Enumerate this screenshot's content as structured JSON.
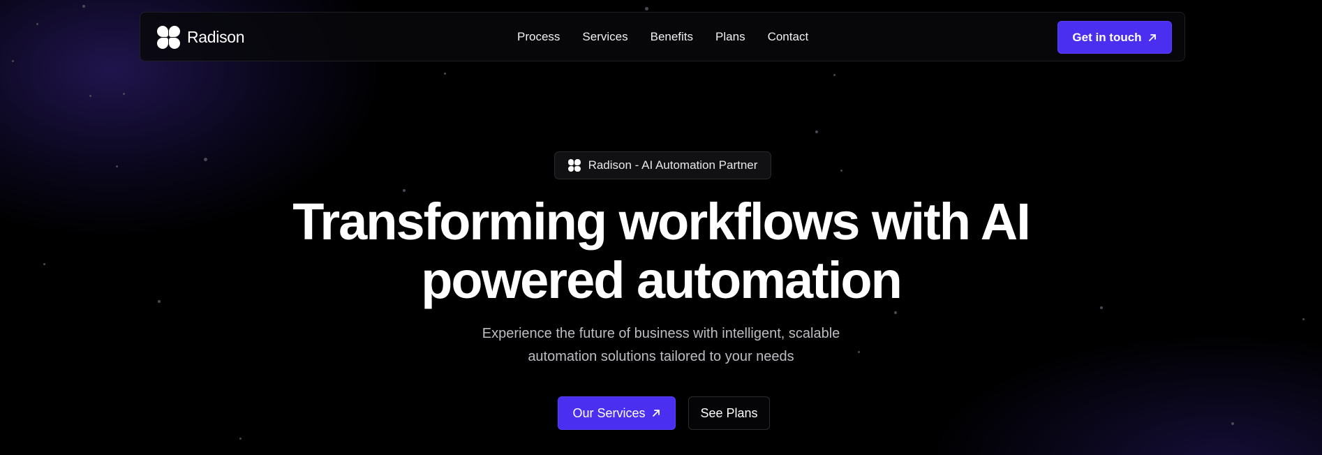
{
  "brand": {
    "name": "Radison",
    "logo_icon": "clover-logo-icon"
  },
  "nav": {
    "links": [
      "Process",
      "Services",
      "Benefits",
      "Plans",
      "Contact"
    ],
    "cta_label": "Get in touch"
  },
  "hero": {
    "badge": "Radison - AI Automation Partner",
    "headline_line1": "Transforming workflows with AI",
    "headline_line2": "powered automation",
    "subtitle_line1": "Experience the future of business with intelligent, scalable",
    "subtitle_line2": "automation solutions tailored to your needs",
    "primary_button": "Our Services",
    "secondary_button": "See Plans"
  },
  "colors": {
    "accent": "#4b2ff0",
    "background": "#000000",
    "glow": "#3a268c"
  }
}
